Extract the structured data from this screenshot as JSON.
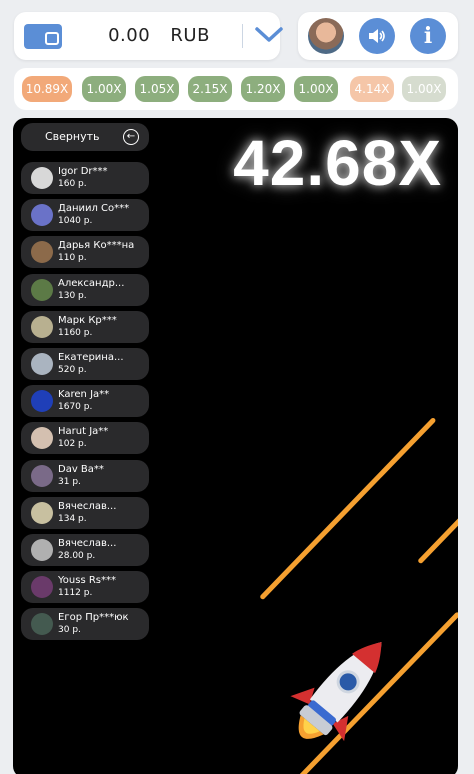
{
  "balance": {
    "amount": "0.00",
    "currency": "RUB"
  },
  "history": [
    {
      "value": "10.89X",
      "color": "#f2a979"
    },
    {
      "value": "1.00X",
      "color": "#8dae7e"
    },
    {
      "value": "1.05X",
      "color": "#8dae7e"
    },
    {
      "value": "2.15X",
      "color": "#8dae7e"
    },
    {
      "value": "1.20X",
      "color": "#8dae7e"
    },
    {
      "value": "1.00X",
      "color": "#8dae7e"
    },
    {
      "value": "4.14X",
      "color": "#f5c6a8"
    },
    {
      "value": "1.00X",
      "color": "#d6dccf"
    }
  ],
  "game": {
    "multiplier": "42.68X",
    "collapse_label": "Свернуть"
  },
  "bets": [
    {
      "name": "Igor Dr***",
      "amount": "160 р.",
      "avatar_color": "#d8d8d8"
    },
    {
      "name": "Даниил Со***",
      "amount": "1040 р.",
      "avatar_color": "#6a72c8"
    },
    {
      "name": "Дарья Ко***на",
      "amount": "110 р.",
      "avatar_color": "#8c6a4a"
    },
    {
      "name": "Александр...",
      "amount": "130 р.",
      "avatar_color": "#5c7a46"
    },
    {
      "name": "Марк Кр***",
      "amount": "1160 р.",
      "avatar_color": "#b8b090"
    },
    {
      "name": "Екатерина...",
      "amount": "520 р.",
      "avatar_color": "#aab4c0"
    },
    {
      "name": "Karen Ja**",
      "amount": "1670 р.",
      "avatar_color": "#1f3fb8"
    },
    {
      "name": "Harut Ja**",
      "amount": "102 р.",
      "avatar_color": "#d4c0b0"
    },
    {
      "name": "Dav Ba**",
      "amount": "31 р.",
      "avatar_color": "#7a6a88"
    },
    {
      "name": "Вячеслав...",
      "amount": "134 р.",
      "avatar_color": "#c8c0a0"
    },
    {
      "name": "Вячеслав...",
      "amount": "28.00 р.",
      "avatar_color": "#b0b0b0"
    },
    {
      "name": "Youss Rs***",
      "amount": "1112 р.",
      "avatar_color": "#6a3a6a"
    },
    {
      "name": "Егор Пр***юк",
      "amount": "30 р.",
      "avatar_color": "#445a50"
    }
  ],
  "colors": {
    "accent": "#5b8ed6",
    "streak": "#f5a030"
  },
  "icons": [
    "wallet-icon",
    "chevron-down-icon",
    "avatar",
    "speaker-icon",
    "info-icon",
    "back-arrow-icon",
    "rocket-icon"
  ]
}
